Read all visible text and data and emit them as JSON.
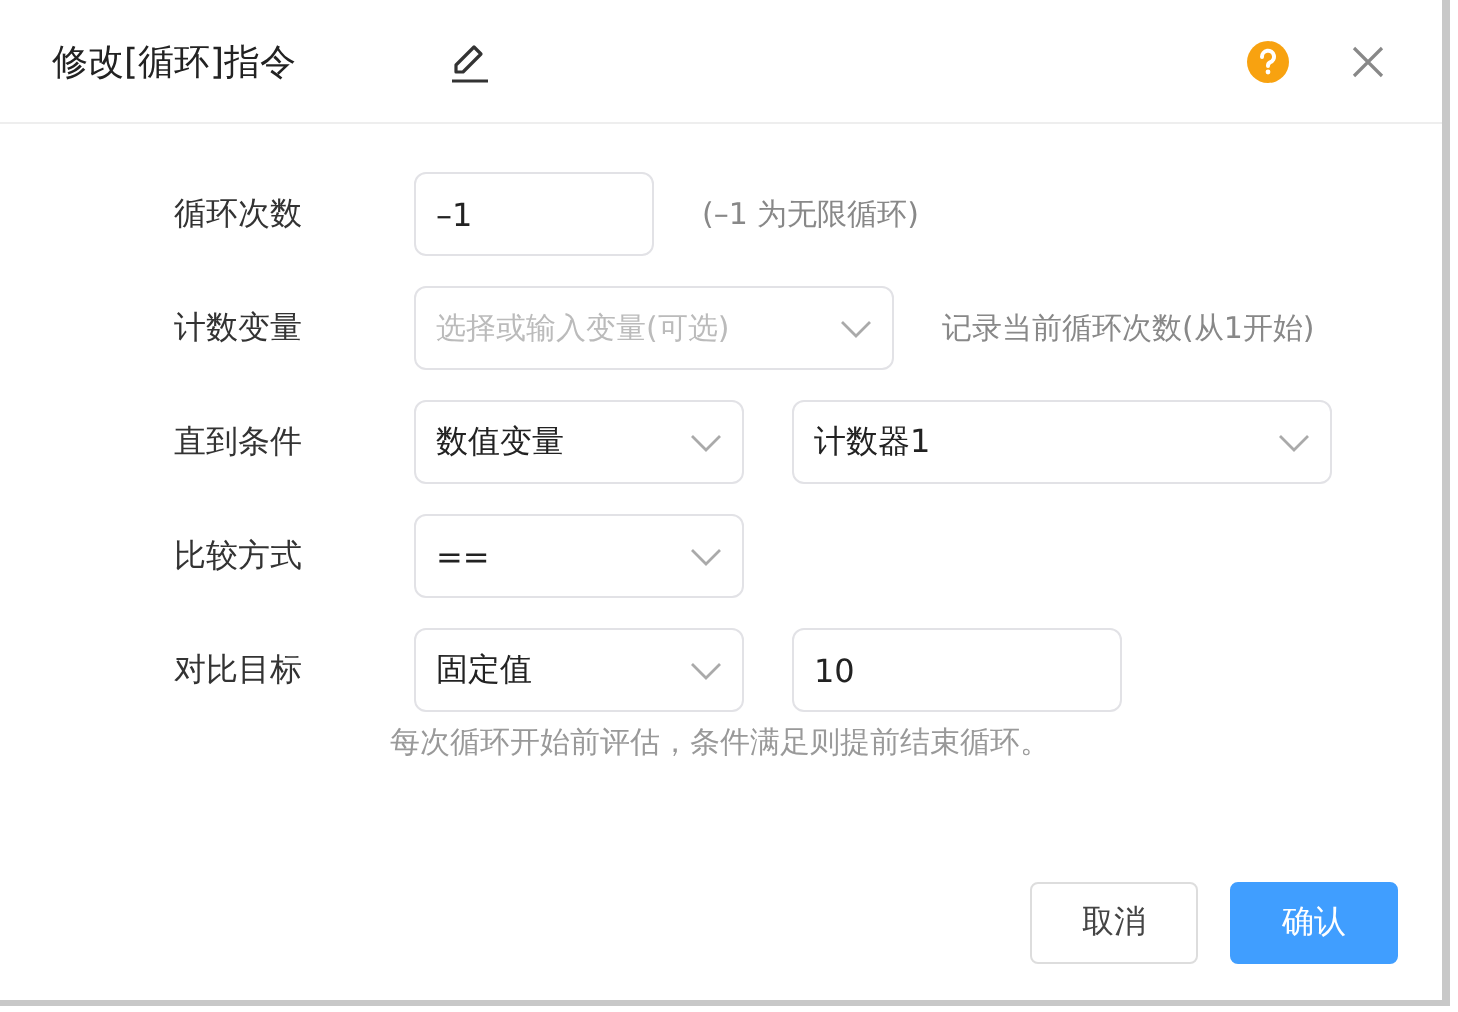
{
  "dialog": {
    "title": "修改[循环]指令"
  },
  "rows": [
    {
      "label": "循环次数",
      "controls": [
        {
          "kind": "input",
          "value": "–1"
        }
      ],
      "note": "(–1 为无限循环)"
    },
    {
      "label": "计数变量",
      "controls": [
        {
          "kind": "select",
          "placeholder": "选择或输入变量(可选)"
        }
      ],
      "note": "记录当前循环次数(从1开始)"
    },
    {
      "label": "直到条件",
      "controls": [
        {
          "kind": "select",
          "value": "数值变量"
        },
        {
          "kind": "select",
          "value": "计数器1"
        }
      ]
    },
    {
      "label": "比较方式",
      "controls": [
        {
          "kind": "select",
          "value": "=="
        }
      ]
    },
    {
      "label": "对比目标",
      "controls": [
        {
          "kind": "select",
          "value": "固定值"
        },
        {
          "kind": "input",
          "value": "10"
        }
      ]
    }
  ],
  "hint": "每次循环开始前评估，条件满足则提前结束循环。",
  "buttons": [
    {
      "label": "取消",
      "kind": "secondary"
    },
    {
      "label": "确认",
      "kind": "primary"
    }
  ]
}
